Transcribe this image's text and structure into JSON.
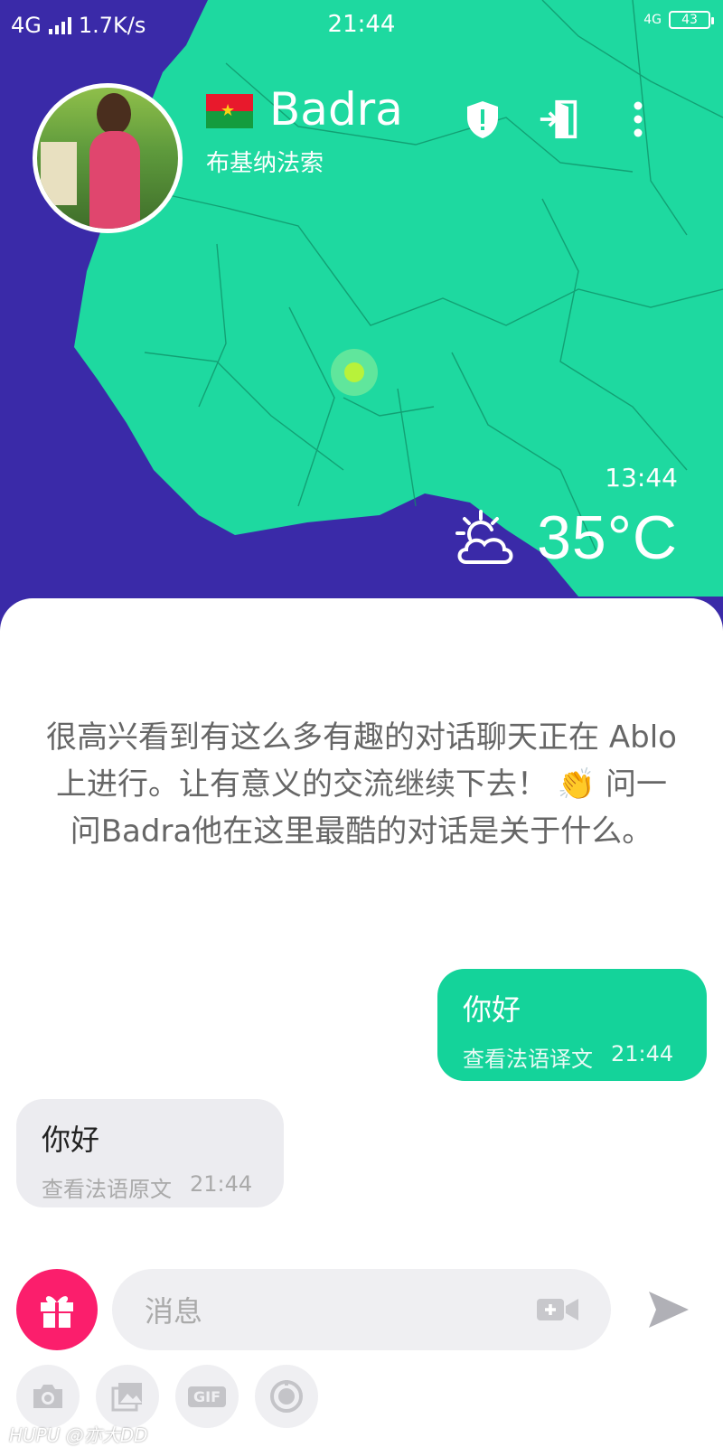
{
  "status_bar": {
    "network": "4G",
    "speed": "1.7K/s",
    "time": "21:44",
    "network_right": "4G",
    "battery": "43"
  },
  "profile": {
    "name": "Badra",
    "country": "布基纳法索",
    "flag": "burkina-faso-flag",
    "local_time": "13:44",
    "temperature": "35°C",
    "weather_icon": "partly-sunny-icon"
  },
  "header_icons": [
    "shield-alert-icon",
    "exit-icon",
    "more-vertical-icon"
  ],
  "chat": {
    "intro": "很高兴看到有这么多有趣的对话聊天正在 Ablo 上进行。让有意义的交流继续下去！ 👏 问一问Badra他在这里最酷的对话是关于什么。",
    "messages": [
      {
        "direction": "outgoing",
        "text": "你好",
        "action": "查看法语译文",
        "time": "21:44"
      },
      {
        "direction": "incoming",
        "text": "你好",
        "action": "查看法语原文",
        "time": "21:44"
      }
    ]
  },
  "composer": {
    "placeholder": "消息",
    "tools": [
      "camera-icon",
      "gallery-icon",
      "gif-icon",
      "timer-icon"
    ],
    "gif_label": "GIF"
  },
  "watermark": "HUPU @亦大DD",
  "colors": {
    "ocean": "#3a2aa8",
    "land": "#1ed9a0",
    "accent": "#14d39a",
    "gift": "#fb1e6c"
  }
}
